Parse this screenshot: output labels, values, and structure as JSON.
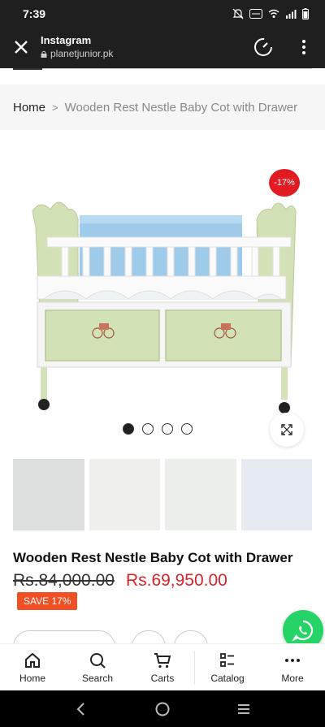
{
  "status_bar": {
    "time": "7:39"
  },
  "browser": {
    "app_title": "Instagram",
    "url": "planetjunior.pk"
  },
  "breadcrumb": {
    "home": "Home",
    "separator": ">",
    "current": "Wooden Rest Nestle Baby Cot with Drawer"
  },
  "product": {
    "discount_badge": "-17%",
    "title": "Wooden Rest Nestle Baby Cot with Drawer",
    "old_price": "Rs.84,000.00",
    "new_price": "Rs.69,950.00",
    "save_label": "SAVE 17%",
    "gallery": {
      "dots": 4,
      "active_index": 0
    },
    "thumbnail_colors": [
      "#dde0de",
      "#efefed",
      "#eceeec",
      "#e6ebf2"
    ]
  },
  "bottom_nav": {
    "items": [
      {
        "label": "Home",
        "icon": "home-icon"
      },
      {
        "label": "Search",
        "icon": "search-icon"
      },
      {
        "label": "Carts",
        "icon": "cart-icon"
      },
      {
        "label": "Catalog",
        "icon": "catalog-icon"
      },
      {
        "label": "More",
        "icon": "more-icon"
      }
    ]
  },
  "colors": {
    "price_red": "#d6232a",
    "save_orange": "#f04e23",
    "badge_red": "#e11b22",
    "whatsapp_green": "#25d366",
    "header_dark": "#1f1f1f"
  }
}
